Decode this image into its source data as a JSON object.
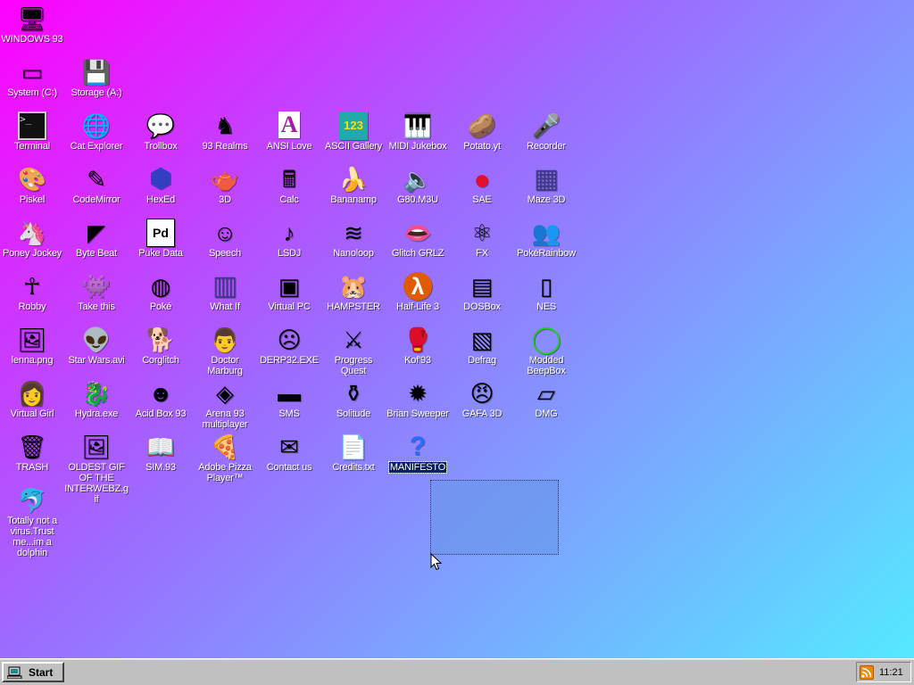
{
  "desktop": {
    "selection_marquee": true,
    "icons": [
      {
        "id": "windows93",
        "label": "WINDOWS 93",
        "icon": "computer-icon",
        "glyph": "🖥",
        "col": 0,
        "row": 0
      },
      {
        "id": "system-c",
        "label": "System (C:)",
        "icon": "hard-drive-icon",
        "glyph": "▭",
        "col": 0,
        "row": 1
      },
      {
        "id": "storage-a",
        "label": "Storage (A:)",
        "icon": "floppy-drive-icon",
        "glyph": "💾",
        "col": 1,
        "row": 1
      },
      {
        "id": "terminal",
        "label": "Terminal",
        "icon": "terminal-icon",
        "glyph": ">_",
        "col": 0,
        "row": 2
      },
      {
        "id": "cat-explorer",
        "label": "Cat Explorer",
        "icon": "globe-icon",
        "glyph": "🌐",
        "col": 1,
        "row": 2
      },
      {
        "id": "trollbox",
        "label": "Trollbox",
        "icon": "chat-smiley-icon",
        "glyph": "💬",
        "col": 2,
        "row": 2
      },
      {
        "id": "93-realms",
        "label": "93 Realms",
        "icon": "knight-icon",
        "glyph": "♞",
        "col": 3,
        "row": 2
      },
      {
        "id": "ansi-love",
        "label": "ANSI Love",
        "icon": "letter-a-icon",
        "glyph": "A",
        "col": 4,
        "row": 2
      },
      {
        "id": "ascii-gallery",
        "label": "ASCII Gallery",
        "icon": "numbers-icon",
        "glyph": "123",
        "col": 5,
        "row": 2
      },
      {
        "id": "midi-jukebox",
        "label": "MIDI Jukebox",
        "icon": "piano-icon",
        "glyph": "🎹",
        "col": 6,
        "row": 2
      },
      {
        "id": "potato-yt",
        "label": "Potato.yt",
        "icon": "potato-icon",
        "glyph": "🥔",
        "col": 7,
        "row": 2
      },
      {
        "id": "recorder",
        "label": "Recorder",
        "icon": "microphone-icon",
        "glyph": "🎤",
        "col": 8,
        "row": 2
      },
      {
        "id": "piskel",
        "label": "Piskel",
        "icon": "palette-icon",
        "glyph": "🎨",
        "col": 0,
        "row": 3
      },
      {
        "id": "codemirror",
        "label": "CodeMirror",
        "icon": "code-icon",
        "glyph": "✎",
        "col": 1,
        "row": 3
      },
      {
        "id": "hexed",
        "label": "HexEd",
        "icon": "hex-cube-icon",
        "glyph": "⬢",
        "col": 2,
        "row": 3
      },
      {
        "id": "3d",
        "label": "3D",
        "icon": "teapot-icon",
        "glyph": "🫖",
        "col": 3,
        "row": 3
      },
      {
        "id": "calc",
        "label": "Calc",
        "icon": "calculator-icon",
        "glyph": "🖩",
        "col": 4,
        "row": 3
      },
      {
        "id": "bananamp",
        "label": "Bananamp",
        "icon": "banana-icon",
        "glyph": "🍌",
        "col": 5,
        "row": 3
      },
      {
        "id": "g80-m3u",
        "label": "G80.M3U",
        "icon": "speaker-doc-icon",
        "glyph": "🔈",
        "col": 6,
        "row": 3
      },
      {
        "id": "sae",
        "label": "SAE",
        "icon": "checker-ball-icon",
        "glyph": "●",
        "col": 7,
        "row": 3
      },
      {
        "id": "maze-3d",
        "label": "Maze 3D",
        "icon": "maze-icon",
        "glyph": "▦",
        "col": 8,
        "row": 3
      },
      {
        "id": "poney-jockey",
        "label": "Poney Jockey",
        "icon": "pony-icon",
        "glyph": "🦄",
        "col": 0,
        "row": 4
      },
      {
        "id": "byte-beat",
        "label": "Byte Beat",
        "icon": "waveform-icon",
        "glyph": "◤",
        "col": 1,
        "row": 4
      },
      {
        "id": "puke-data",
        "label": "Puke Data",
        "icon": "pd-icon",
        "glyph": "Pd",
        "col": 2,
        "row": 4
      },
      {
        "id": "speech",
        "label": "Speech",
        "icon": "face-icon",
        "glyph": "☺",
        "col": 3,
        "row": 4
      },
      {
        "id": "lsdj",
        "label": "LSDJ",
        "icon": "lsdj-icon",
        "glyph": "♪",
        "col": 4,
        "row": 4
      },
      {
        "id": "nanoloop",
        "label": "Nanoloop",
        "icon": "sound-wave-icon",
        "glyph": "≋",
        "col": 5,
        "row": 4
      },
      {
        "id": "glitch-grlz",
        "label": "Glitch GRLZ",
        "icon": "lips-icon",
        "glyph": "👄",
        "col": 6,
        "row": 4
      },
      {
        "id": "fx",
        "label": "FX",
        "icon": "atom-icon",
        "glyph": "⚛",
        "col": 7,
        "row": 4
      },
      {
        "id": "pokerainbow",
        "label": "PokéRainbow",
        "icon": "people-icon",
        "glyph": "👥",
        "col": 8,
        "row": 4
      },
      {
        "id": "robby",
        "label": "Robby",
        "icon": "stick-figure-icon",
        "glyph": "☥",
        "col": 0,
        "row": 5
      },
      {
        "id": "take-this",
        "label": "Take this",
        "icon": "sprite-icon",
        "glyph": "👾",
        "col": 1,
        "row": 5
      },
      {
        "id": "poke-glitch",
        "label": "Poké",
        "icon": "glitch-pokeball-icon",
        "glyph": "◍",
        "col": 2,
        "row": 5
      },
      {
        "id": "what-if",
        "label": "What If",
        "icon": "matrix-icon",
        "glyph": "▥",
        "col": 3,
        "row": 5
      },
      {
        "id": "virtual-pc",
        "label": "Virtual PC",
        "icon": "window-icon",
        "glyph": "▣",
        "col": 4,
        "row": 5
      },
      {
        "id": "hampster",
        "label": "HAMPSTER",
        "icon": "hamster-icon",
        "glyph": "🐹",
        "col": 5,
        "row": 5
      },
      {
        "id": "half-life-3",
        "label": "Half-Life 3",
        "icon": "lambda-icon",
        "glyph": "λ",
        "col": 6,
        "row": 5
      },
      {
        "id": "dosbox",
        "label": "DOSBox",
        "icon": "dos-box-icon",
        "glyph": "▤",
        "col": 7,
        "row": 5
      },
      {
        "id": "nes",
        "label": "NES",
        "icon": "nes-console-icon",
        "glyph": "▯",
        "col": 8,
        "row": 5
      },
      {
        "id": "lenna-png",
        "label": "lenna.png",
        "icon": "image-file-icon",
        "glyph": "🖼",
        "col": 0,
        "row": 6
      },
      {
        "id": "star-wars",
        "label": "Star Wars.avi",
        "icon": "yoda-icon",
        "glyph": "👽",
        "col": 1,
        "row": 6
      },
      {
        "id": "corglitch",
        "label": "Corglitch",
        "icon": "corgi-icon",
        "glyph": "🐕",
        "col": 2,
        "row": 6
      },
      {
        "id": "doctor-marburg",
        "label": "Doctor Marburg",
        "icon": "doctor-icon",
        "glyph": "👨",
        "col": 3,
        "row": 6
      },
      {
        "id": "derp32",
        "label": "DERP32.EXE",
        "icon": "derp-face-icon",
        "glyph": "☹",
        "col": 4,
        "row": 6
      },
      {
        "id": "progress-quest",
        "label": "Progress Quest",
        "icon": "crossed-swords-icon",
        "glyph": "⚔",
        "col": 5,
        "row": 6
      },
      {
        "id": "kof93",
        "label": "Kof'93",
        "icon": "fighter-icon",
        "glyph": "🥊",
        "col": 6,
        "row": 6
      },
      {
        "id": "defrag",
        "label": "Defrag",
        "icon": "defrag-icon",
        "glyph": "▧",
        "col": 7,
        "row": 6
      },
      {
        "id": "modded-beepbox",
        "label": "Modded BeepBox",
        "icon": "ring-icon",
        "glyph": "◯",
        "col": 8,
        "row": 6
      },
      {
        "id": "virtual-girl",
        "label": "Virtual Girl",
        "icon": "portrait-icon",
        "glyph": "👩",
        "col": 0,
        "row": 7
      },
      {
        "id": "hydra-exe",
        "label": "Hydra.exe",
        "icon": "dragon-icon",
        "glyph": "🐉",
        "col": 1,
        "row": 7
      },
      {
        "id": "acid-box-93",
        "label": "Acid Box 93",
        "icon": "acid-smiley-icon",
        "glyph": "☻",
        "col": 2,
        "row": 7
      },
      {
        "id": "arena-93",
        "label": "Arena 93 multiplayer",
        "icon": "cube-icon",
        "glyph": "◈",
        "col": 3,
        "row": 7
      },
      {
        "id": "sms",
        "label": "SMS",
        "icon": "sms-console-icon",
        "glyph": "▬",
        "col": 4,
        "row": 7
      },
      {
        "id": "solitude",
        "label": "Solitude",
        "icon": "bottle-icon",
        "glyph": "⚱",
        "col": 5,
        "row": 7
      },
      {
        "id": "brian-sweeper",
        "label": "Brian Sweeper",
        "icon": "mine-icon",
        "glyph": "✹",
        "col": 6,
        "row": 7
      },
      {
        "id": "gafa-3d",
        "label": "GAFA 3D",
        "icon": "soldier-face-icon",
        "glyph": "😠",
        "col": 7,
        "row": 7
      },
      {
        "id": "dmg",
        "label": "DMG",
        "icon": "cartridge-icon",
        "glyph": "▱",
        "col": 8,
        "row": 7
      },
      {
        "id": "trash",
        "label": "TRASH",
        "icon": "recycle-bin-icon",
        "glyph": "🗑",
        "col": 0,
        "row": 8
      },
      {
        "id": "oldest-gif",
        "label": "OLDEST GIF OF THE INTERWEBZ.gif",
        "icon": "image-file-icon",
        "glyph": "🖼",
        "col": 1,
        "row": 8
      },
      {
        "id": "sim93",
        "label": "SIM.93",
        "icon": "book-icon",
        "glyph": "📖",
        "col": 2,
        "row": 8
      },
      {
        "id": "adobe-pizza",
        "label": "Adobe Pizza Player™",
        "icon": "pizza-icon",
        "glyph": "🍕",
        "col": 3,
        "row": 8
      },
      {
        "id": "contact-us",
        "label": "Contact us",
        "icon": "mail-pen-icon",
        "glyph": "✉",
        "col": 4,
        "row": 8
      },
      {
        "id": "credits-txt",
        "label": "Credits.txt",
        "icon": "text-file-icon",
        "glyph": "📄",
        "col": 5,
        "row": 8
      },
      {
        "id": "manifesto",
        "label": "MANIFESTO",
        "icon": "question-mark-icon",
        "glyph": "?",
        "col": 6,
        "row": 8,
        "selected": true
      },
      {
        "id": "dolphin",
        "label": "Totally not a virus.Trust me...im a dolphin",
        "icon": "dolphin-icon",
        "glyph": "🐬",
        "col": 0,
        "row": 9
      }
    ]
  },
  "taskbar": {
    "start_label": "Start",
    "tray_icon": "rss-icon",
    "clock": "11:21"
  },
  "colors": {
    "gradient_start": "#ff00ff",
    "gradient_mid": "#9b6cff",
    "gradient_end": "#55e9ff",
    "selection": "#0a246a"
  }
}
